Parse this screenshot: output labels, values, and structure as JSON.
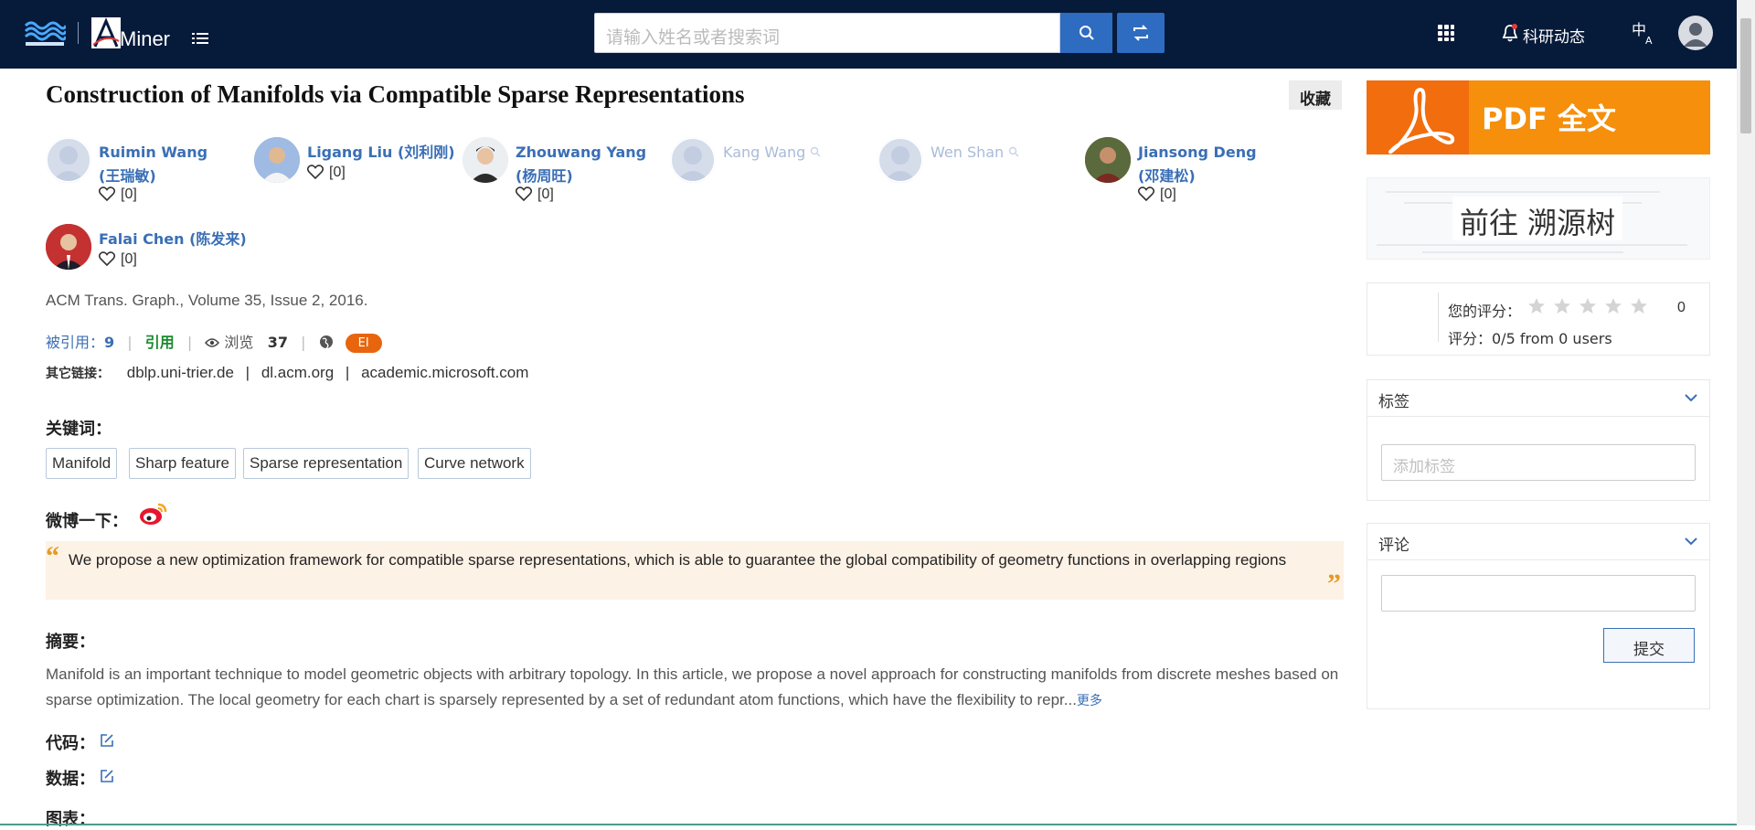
{
  "header": {
    "logo_text": "Miner",
    "search_placeholder": "请输入姓名或者搜索词",
    "news_label": "科研动态"
  },
  "paper": {
    "title": "Construction of Manifolds via Compatible Sparse Representations",
    "collect_label": "收藏",
    "authors": [
      {
        "name_line1": "Ruimin Wang",
        "name_line2": "(王瑞敏)",
        "likes": "[0]"
      },
      {
        "name_line1": "Ligang Liu (刘利刚)",
        "likes": "[0]"
      },
      {
        "name_line1": "Zhouwang Yang",
        "name_line2": "(杨周旺)",
        "likes": "[0]"
      },
      {
        "name_line1": "Kang Wang"
      },
      {
        "name_line1": "Wen Shan"
      },
      {
        "name_line1": "Jiansong Deng",
        "name_line2": "(邓建松)",
        "likes": "[0]"
      },
      {
        "name_line1": "Falai Chen (陈发来)",
        "likes": "[0]"
      }
    ],
    "venue": "ACM Trans. Graph., Volume 35, Issue 2, 2016.",
    "cited_label": "被引用：",
    "cited_count": "9",
    "cite_label": "引用",
    "views_label": "浏览",
    "views_count": "37",
    "index_badge": "EI",
    "other_links_label": "其它链接：",
    "other_links": [
      "dblp.uni-trier.de",
      "dl.acm.org",
      "academic.microsoft.com"
    ],
    "keywords_label": "关键词：",
    "keywords": [
      "Manifold",
      "Sharp feature",
      "Sparse representation",
      "Curve network"
    ],
    "weibo_label": "微博一下：",
    "highlight": "We propose a new optimization framework for compatible sparse representations, which is able to guarantee the global compatibility of geometry functions in overlapping regions",
    "abstract_label": "摘要：",
    "abstract": "Manifold is an important technique to model geometric objects with arbitrary topology. In this article, we propose a novel approach for constructing manifolds from discrete meshes based on sparse optimization. The local geometry for each chart is sparsely represented by a set of redundant atom functions, which have the flexibility to repr...",
    "more_label": "更多",
    "code_label": "代码：",
    "data_label": "数据：",
    "figures_label": "图表："
  },
  "sidebar": {
    "pdf_label": "PDF 全文",
    "trace_label": "前往 溯源树",
    "your_rating_label": "您的评分：",
    "your_rating_value": "0",
    "rating_summary": "评分：0/5 from 0 users",
    "stars_max": 5,
    "tags_title": "标签",
    "tag_placeholder": "添加标签",
    "comments_title": "评论",
    "submit_label": "提交"
  },
  "colors": {
    "header_bg": "#061a3a",
    "accent_blue": "#2d6cc0",
    "link_blue": "#3a6fb5",
    "pdf_orange": "#f58f0c",
    "badge_orange": "#e8650d",
    "quote_bg": "#fdf2e6"
  }
}
